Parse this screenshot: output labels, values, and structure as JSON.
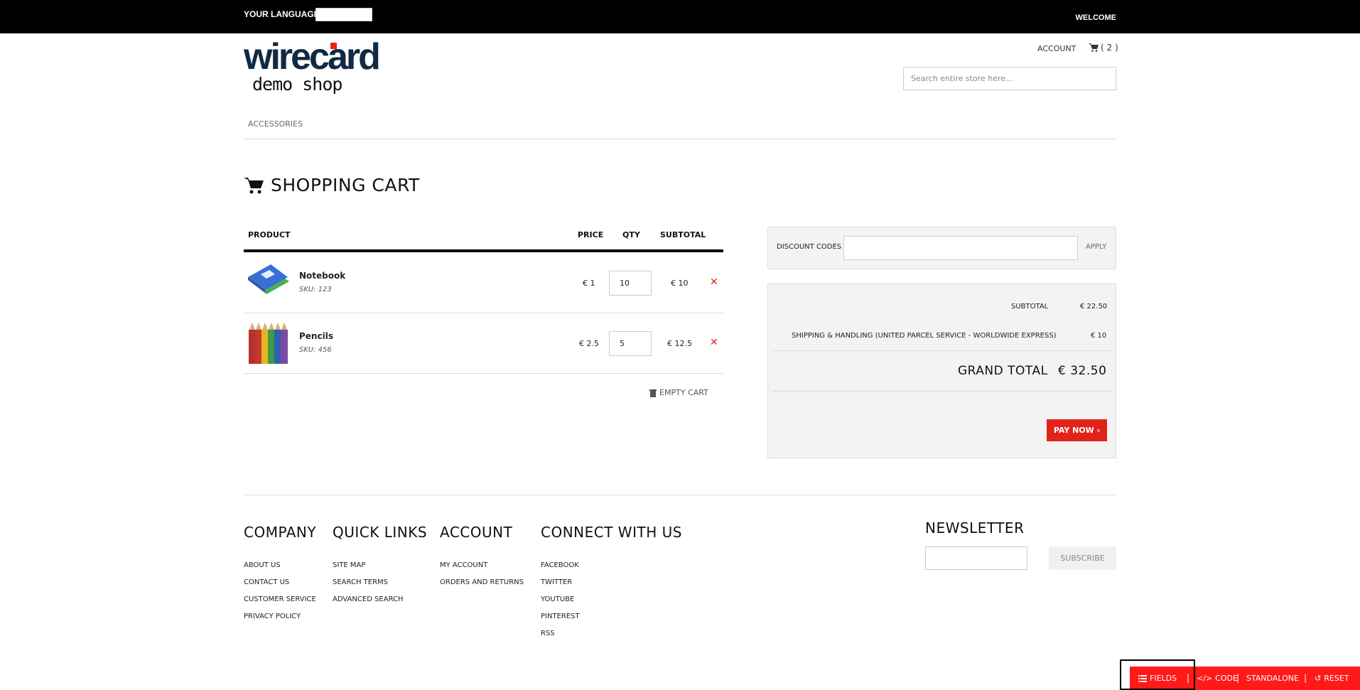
{
  "topbar": {
    "language_label": "YOUR LANGUAGE:",
    "welcome": "WELCOME"
  },
  "header": {
    "logo_word": "wirecard",
    "logo_sub": "demo shop",
    "account": "ACCOUNT",
    "cart_count": "( 2 )",
    "search_placeholder": "Search entire store here..."
  },
  "nav": {
    "items": [
      "ACCESSORIES"
    ]
  },
  "cart": {
    "title": "SHOPPING CART",
    "columns": {
      "product": "PRODUCT",
      "price": "PRICE",
      "qty": "QTY",
      "subtotal": "SUBTOTAL"
    },
    "items": [
      {
        "name": "Notebook",
        "sku": "SKU: 123",
        "price": "€ 1",
        "qty": "10",
        "subtotal": "€ 10",
        "image": "notebook-icon"
      },
      {
        "name": "Pencils",
        "sku": "SKU: 456",
        "price": "€ 2.5",
        "qty": "5",
        "subtotal": "€ 12.5",
        "image": "pencils-icon"
      }
    ],
    "empty_cart": "EMPTY CART"
  },
  "discount": {
    "label": "DISCOUNT CODES",
    "apply": "APPLY"
  },
  "totals": {
    "subtotal_label": "SUBTOTAL",
    "subtotal_value": "€ 22.50",
    "shipping_label": "SHIPPING & HANDLING (UNITED PARCEL SERVICE - WORLDWIDE EXPRESS)",
    "shipping_value": "€ 10",
    "grand_label": "GRAND TOTAL",
    "grand_value": "€ 32.50",
    "pay_now": "PAY NOW ›"
  },
  "footer": {
    "company": {
      "title": "COMPANY",
      "links": [
        "ABOUT US",
        "CONTACT US",
        "CUSTOMER SERVICE",
        "PRIVACY POLICY"
      ]
    },
    "quick_links": {
      "title": "QUICK LINKS",
      "links": [
        "SITE MAP",
        "SEARCH TERMS",
        "ADVANCED SEARCH"
      ]
    },
    "account": {
      "title": "ACCOUNT",
      "links": [
        "MY ACCOUNT",
        "ORDERS AND RETURNS"
      ]
    },
    "connect": {
      "title": "CONNECT WITH US",
      "links": [
        "FACEBOOK",
        "TWITTER",
        "YOUTUBE",
        "PINTEREST",
        "RSS"
      ]
    },
    "newsletter": {
      "title": "NEWSLETTER",
      "subscribe": "SUBSCRIBE"
    }
  },
  "devbar": {
    "fields": "FIELDS",
    "code": "CODE",
    "standalone": "STANDALONE",
    "reset": "RESET"
  },
  "colors": {
    "accent": "#e2231a",
    "devbar": "#ff1a1a",
    "logo": "#102a43"
  }
}
